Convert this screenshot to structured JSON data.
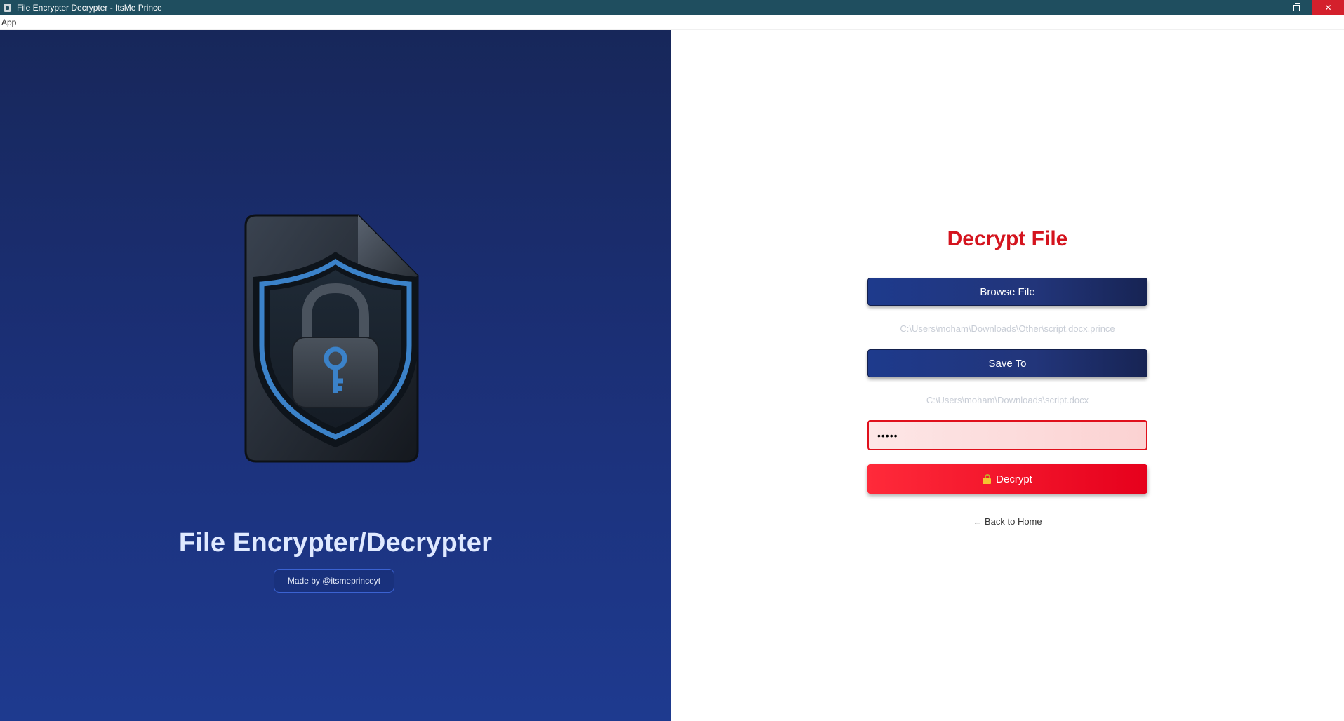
{
  "window": {
    "title": "File Encrypter Decrypter - ItsMe Prince",
    "controls": [
      "minimize",
      "restore",
      "close"
    ]
  },
  "menu": {
    "items": [
      "App"
    ]
  },
  "hero": {
    "logo_icon": "shield-lock-file-icon",
    "title": "File Encrypter/Decrypter",
    "credit": "Made by @itsmeprinceyt"
  },
  "form": {
    "heading": "Decrypt File",
    "browse_label": "Browse File",
    "browse_path": "C:\\Users\\moham\\Downloads\\Other\\script.docx.prince",
    "save_label": "Save To",
    "save_path": "C:\\Users\\moham\\Downloads\\script.docx",
    "password_value": "•••••",
    "decrypt_label": "Decrypt",
    "back_label": "← Back to Home"
  },
  "colors": {
    "accent_red": "#d4141e",
    "button_blue": "#1e3a8c",
    "titlebar": "#1f4e5f"
  }
}
